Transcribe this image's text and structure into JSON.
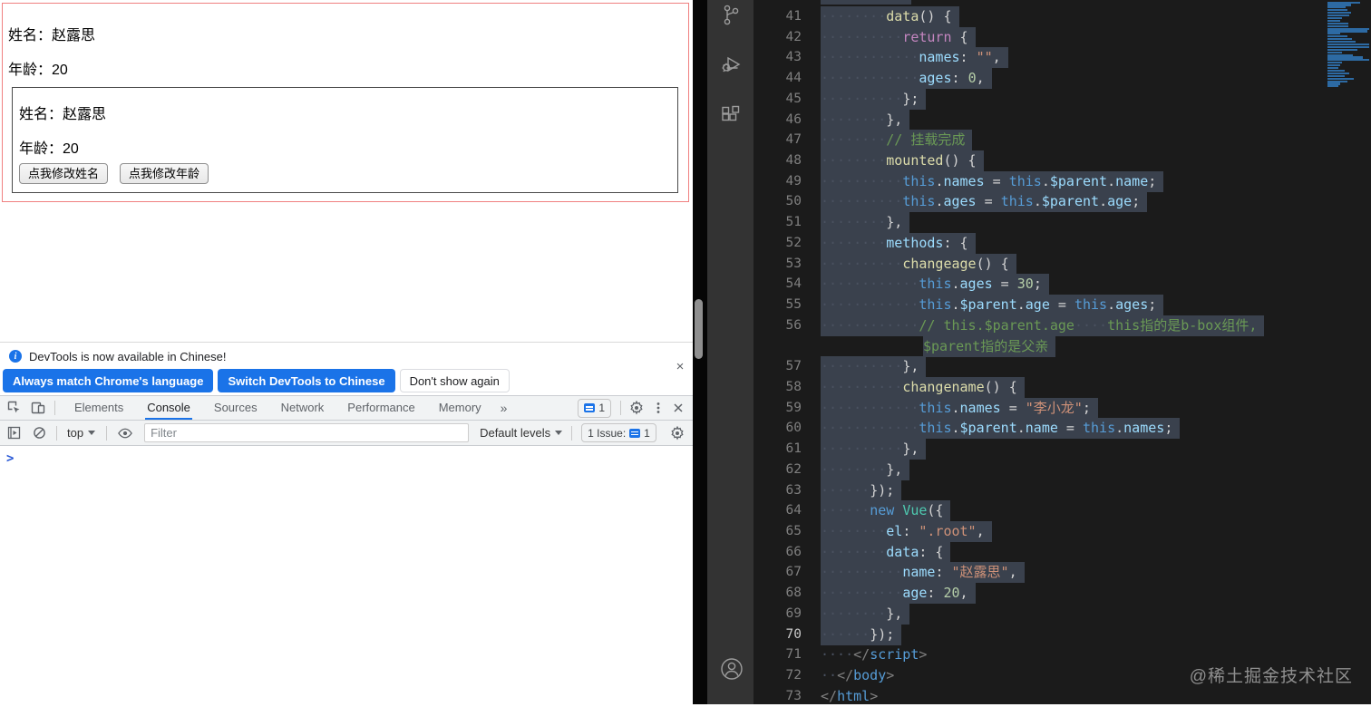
{
  "page": {
    "outer": {
      "name_label": "姓名：",
      "name_value": "赵露思",
      "age_label": "年龄：",
      "age_value": "20"
    },
    "inner": {
      "name_label": "姓名：",
      "name_value": "赵露思",
      "age_label": "年龄：",
      "age_value": "20"
    },
    "buttons": [
      {
        "label": "点我修改姓名"
      },
      {
        "label": "点我修改年龄"
      }
    ],
    "border_colors": {
      "outer": "#f08080",
      "inner": "#4a4a4a"
    }
  },
  "devtools": {
    "banner": {
      "info_icon": "info-icon",
      "text": "DevTools is now available in Chinese!",
      "close_icon": "×",
      "buttons": [
        {
          "label": "Always match Chrome's language",
          "style": "primary"
        },
        {
          "label": "Switch DevTools to Chinese",
          "style": "primary"
        },
        {
          "label": "Don't show again",
          "style": "secondary"
        }
      ]
    },
    "tabbar": {
      "left_icons": [
        "inspect-icon",
        "device-toolbar-icon"
      ],
      "tabs": [
        "Elements",
        "Console",
        "Sources",
        "Network",
        "Performance",
        "Memory"
      ],
      "active_tab": "Console",
      "more_tabs": "»",
      "messages_count": "1",
      "right_icons": [
        "settings-gear-icon",
        "kebab-menu-icon",
        "close-icon"
      ]
    },
    "toolbar": {
      "left_icons": [
        "console-sidebar-icon",
        "clear-console-icon"
      ],
      "context": "top",
      "eye_icon": "live-expression-eye-icon",
      "filter_placeholder": "Filter",
      "levels": "Default levels",
      "issues_label": "1 Issue:",
      "issues_count": "1",
      "gear_icon": "settings-gear-icon"
    },
    "console": {
      "prompt": ">"
    },
    "accent_color": "#1a73e8"
  },
  "editor": {
    "token_colors": {
      "fn": "#dcdcaa",
      "ctl": "#c586c0",
      "prop": "#9cdcfe",
      "str": "#ce9178",
      "num": "#b5cea8",
      "cmt": "#6a9955",
      "pun": "#d4d4d4",
      "kw": "#569cd6",
      "cls": "#4ec9b0",
      "tag": "#569cd6",
      "brk": "#808080",
      "ws": "#4a5160"
    },
    "selection_color": "#3a414d",
    "minimap_color": "#2d6aa3",
    "minimap_prefix_widths": [
      36,
      26
    ],
    "lines": [
      {
        "n": 41,
        "i": 8,
        "sel": true,
        "t": [
          [
            "fn",
            "data"
          ],
          [
            "pun",
            "() {"
          ]
        ]
      },
      {
        "n": 42,
        "i": 10,
        "sel": true,
        "t": [
          [
            "ctl",
            "return"
          ],
          [
            "pun",
            " {"
          ]
        ]
      },
      {
        "n": 43,
        "i": 12,
        "sel": true,
        "t": [
          [
            "prop",
            "names"
          ],
          [
            "pun",
            ": "
          ],
          [
            "str",
            "\"\""
          ],
          [
            "pun",
            ","
          ]
        ]
      },
      {
        "n": 44,
        "i": 12,
        "sel": true,
        "t": [
          [
            "prop",
            "ages"
          ],
          [
            "pun",
            ": "
          ],
          [
            "num",
            "0"
          ],
          [
            "pun",
            ","
          ]
        ]
      },
      {
        "n": 45,
        "i": 10,
        "sel": true,
        "t": [
          [
            "pun",
            "};"
          ]
        ]
      },
      {
        "n": 46,
        "i": 8,
        "sel": true,
        "t": [
          [
            "pun",
            "},"
          ]
        ]
      },
      {
        "n": 47,
        "i": 8,
        "sel": true,
        "t": [
          [
            "cmt",
            "// 挂载完成"
          ]
        ]
      },
      {
        "n": 48,
        "i": 8,
        "sel": true,
        "t": [
          [
            "fn",
            "mounted"
          ],
          [
            "pun",
            "() {"
          ]
        ]
      },
      {
        "n": 49,
        "i": 10,
        "sel": true,
        "t": [
          [
            "kw",
            "this"
          ],
          [
            "pun",
            "."
          ],
          [
            "prop",
            "names"
          ],
          [
            "pun",
            " = "
          ],
          [
            "kw",
            "this"
          ],
          [
            "pun",
            "."
          ],
          [
            "prop",
            "$parent"
          ],
          [
            "pun",
            "."
          ],
          [
            "prop",
            "name"
          ],
          [
            "pun",
            ";"
          ]
        ]
      },
      {
        "n": 50,
        "i": 10,
        "sel": true,
        "t": [
          [
            "kw",
            "this"
          ],
          [
            "pun",
            "."
          ],
          [
            "prop",
            "ages"
          ],
          [
            "pun",
            " = "
          ],
          [
            "kw",
            "this"
          ],
          [
            "pun",
            "."
          ],
          [
            "prop",
            "$parent"
          ],
          [
            "pun",
            "."
          ],
          [
            "prop",
            "age"
          ],
          [
            "pun",
            ";"
          ]
        ]
      },
      {
        "n": 51,
        "i": 8,
        "sel": true,
        "t": [
          [
            "pun",
            "},"
          ]
        ]
      },
      {
        "n": 52,
        "i": 8,
        "sel": true,
        "t": [
          [
            "prop",
            "methods"
          ],
          [
            "pun",
            ": {"
          ]
        ]
      },
      {
        "n": 53,
        "i": 10,
        "sel": true,
        "t": [
          [
            "fn",
            "changeage"
          ],
          [
            "pun",
            "() {"
          ]
        ]
      },
      {
        "n": 54,
        "i": 12,
        "sel": true,
        "t": [
          [
            "kw",
            "this"
          ],
          [
            "pun",
            "."
          ],
          [
            "prop",
            "ages"
          ],
          [
            "pun",
            " = "
          ],
          [
            "num",
            "30"
          ],
          [
            "pun",
            ";"
          ]
        ]
      },
      {
        "n": 55,
        "i": 12,
        "sel": true,
        "t": [
          [
            "kw",
            "this"
          ],
          [
            "pun",
            "."
          ],
          [
            "prop",
            "$parent"
          ],
          [
            "pun",
            "."
          ],
          [
            "prop",
            "age"
          ],
          [
            "pun",
            " = "
          ],
          [
            "kw",
            "this"
          ],
          [
            "pun",
            "."
          ],
          [
            "prop",
            "ages"
          ],
          [
            "pun",
            ";"
          ]
        ]
      },
      {
        "n": 56,
        "i": 12,
        "sel": true,
        "t": [
          [
            "cmt",
            "// this.$parent.age"
          ],
          [
            "ws",
            "····"
          ],
          [
            "cmt",
            "this指的是b-box组件,"
          ]
        ]
      },
      {
        "n": null,
        "i": 0,
        "pad": 113,
        "sel": true,
        "t": [
          [
            "cmt",
            "$parent指的是父亲"
          ]
        ]
      },
      {
        "n": 57,
        "i": 10,
        "sel": true,
        "t": [
          [
            "pun",
            "},"
          ]
        ]
      },
      {
        "n": 58,
        "i": 10,
        "sel": true,
        "t": [
          [
            "fn",
            "changename"
          ],
          [
            "pun",
            "() {"
          ]
        ]
      },
      {
        "n": 59,
        "i": 12,
        "sel": true,
        "t": [
          [
            "kw",
            "this"
          ],
          [
            "pun",
            "."
          ],
          [
            "prop",
            "names"
          ],
          [
            "pun",
            " = "
          ],
          [
            "str",
            "\"李小龙\""
          ],
          [
            "pun",
            ";"
          ]
        ]
      },
      {
        "n": 60,
        "i": 12,
        "sel": true,
        "t": [
          [
            "kw",
            "this"
          ],
          [
            "pun",
            "."
          ],
          [
            "prop",
            "$parent"
          ],
          [
            "pun",
            "."
          ],
          [
            "prop",
            "name"
          ],
          [
            "pun",
            " = "
          ],
          [
            "kw",
            "this"
          ],
          [
            "pun",
            "."
          ],
          [
            "prop",
            "names"
          ],
          [
            "pun",
            ";"
          ]
        ]
      },
      {
        "n": 61,
        "i": 10,
        "sel": true,
        "t": [
          [
            "pun",
            "},"
          ]
        ]
      },
      {
        "n": 62,
        "i": 8,
        "sel": true,
        "t": [
          [
            "pun",
            "},"
          ]
        ]
      },
      {
        "n": 63,
        "i": 6,
        "sel": true,
        "t": [
          [
            "pun",
            "});"
          ]
        ]
      },
      {
        "n": 64,
        "i": 6,
        "sel": true,
        "t": [
          [
            "kw",
            "new"
          ],
          [
            "pun",
            " "
          ],
          [
            "cls",
            "Vue"
          ],
          [
            "pun",
            "({"
          ]
        ]
      },
      {
        "n": 65,
        "i": 8,
        "sel": true,
        "t": [
          [
            "prop",
            "el"
          ],
          [
            "pun",
            ": "
          ],
          [
            "str",
            "\".root\""
          ],
          [
            "pun",
            ","
          ]
        ]
      },
      {
        "n": 66,
        "i": 8,
        "sel": true,
        "t": [
          [
            "prop",
            "data"
          ],
          [
            "pun",
            ": {"
          ]
        ]
      },
      {
        "n": 67,
        "i": 10,
        "sel": true,
        "t": [
          [
            "prop",
            "name"
          ],
          [
            "pun",
            ": "
          ],
          [
            "str",
            "\"赵露思\""
          ],
          [
            "pun",
            ","
          ]
        ]
      },
      {
        "n": 68,
        "i": 10,
        "sel": true,
        "t": [
          [
            "prop",
            "age"
          ],
          [
            "pun",
            ": "
          ],
          [
            "num",
            "20"
          ],
          [
            "pun",
            ","
          ]
        ]
      },
      {
        "n": 69,
        "i": 8,
        "sel": true,
        "t": [
          [
            "pun",
            "},"
          ]
        ]
      },
      {
        "n": 70,
        "i": 6,
        "sel": true,
        "active": true,
        "t": [
          [
            "pun",
            "});"
          ]
        ]
      },
      {
        "n": 71,
        "i": 4,
        "sel": false,
        "t": [
          [
            "brk",
            "</"
          ],
          [
            "tag",
            "script"
          ],
          [
            "brk",
            ">"
          ]
        ]
      },
      {
        "n": 72,
        "i": 2,
        "sel": false,
        "t": [
          [
            "brk",
            "</"
          ],
          [
            "tag",
            "body"
          ],
          [
            "brk",
            ">"
          ]
        ]
      },
      {
        "n": 73,
        "i": 0,
        "sel": false,
        "t": [
          [
            "brk",
            "</"
          ],
          [
            "tag",
            "html"
          ],
          [
            "brk",
            ">"
          ]
        ]
      }
    ],
    "watermark": "@稀土掘金技术社区"
  },
  "activity_bar": {
    "icons": [
      "source-control-icon",
      "run-debug-icon",
      "extensions-icon"
    ],
    "bottom_icon": "account-icon"
  }
}
